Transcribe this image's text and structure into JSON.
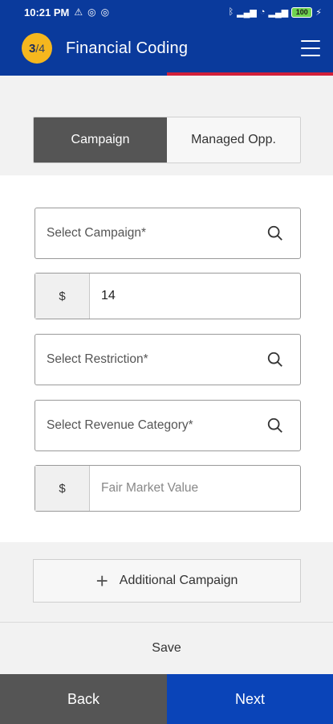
{
  "status_bar": {
    "time": "10:21 PM",
    "battery": "100"
  },
  "header": {
    "step_current": "3",
    "step_total": "/4",
    "title": "Financial Coding"
  },
  "tabs": [
    {
      "label": "Campaign",
      "active": true
    },
    {
      "label": "Managed Opp.",
      "active": false
    }
  ],
  "form": {
    "campaign_placeholder": "Select Campaign*",
    "amount_prefix": "$",
    "amount_value": "14",
    "restriction_placeholder": "Select Restriction*",
    "revenue_category_placeholder": "Select Revenue Category*",
    "fmv_prefix": "$",
    "fmv_placeholder": "Fair Market Value"
  },
  "actions": {
    "additional_campaign": "Additional Campaign",
    "save": "Save",
    "back": "Back",
    "next": "Next"
  },
  "colors": {
    "header_blue": "#0a3a9c",
    "accent_red": "#d2203a",
    "badge_yellow": "#f5b71e",
    "next_blue": "#0a44b8",
    "dark_gray": "#555555"
  }
}
